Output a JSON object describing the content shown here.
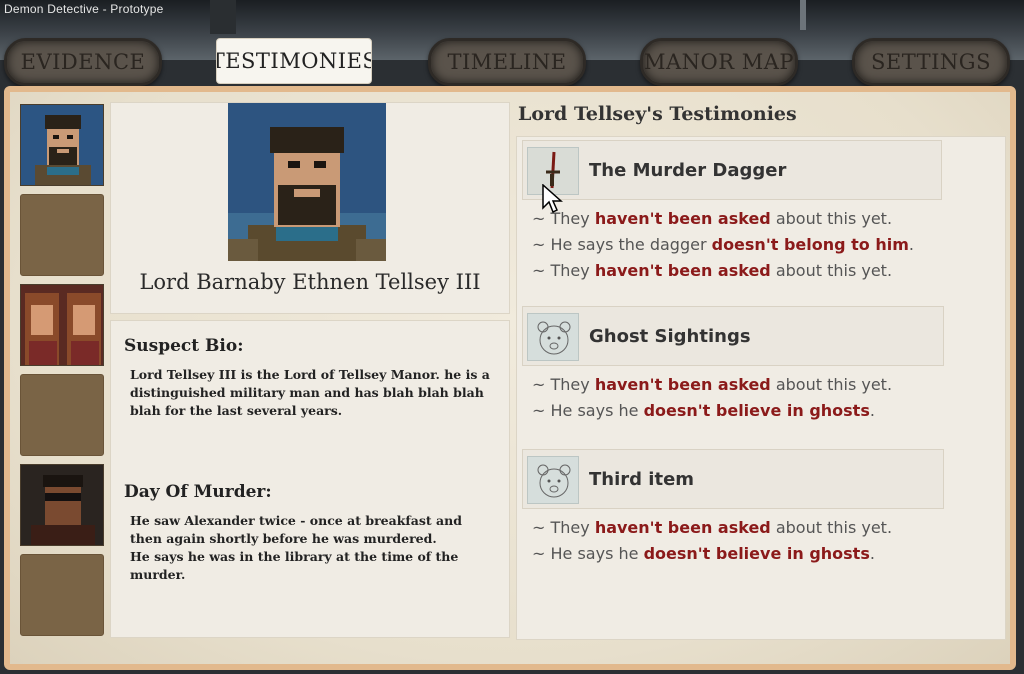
{
  "window": {
    "title": "Demon Detective - Prototype"
  },
  "tabs": [
    {
      "label": "EVIDENCE"
    },
    {
      "label": "TESTIMONIES"
    },
    {
      "label": "TIMELINE"
    },
    {
      "label": "MANOR MAP"
    },
    {
      "label": "SETTINGS"
    }
  ],
  "active_tab": "TESTIMONIES",
  "suspect": {
    "name": "Lord Barnaby Ethnen Tellsey III",
    "bio_heading": "Suspect Bio:",
    "bio_text": "Lord Tellsey III is the Lord of Tellsey Manor. he is a distinguished military man and has blah blah blah blah for the last several years.",
    "day_heading": "Day Of Murder:",
    "day_text_1": "He saw Alexander twice - once at breakfast and then again shortly before he was murdered.",
    "day_text_2": "He says he was in the library at the time of the murder."
  },
  "testimonies": {
    "title": "Lord Tellsey's Testimonies",
    "items": [
      {
        "title": "The Murder Dagger",
        "icon": "dagger-icon",
        "lines": [
          {
            "pre": "~ They ",
            "hl": "haven't been asked",
            "post": " about this yet."
          },
          {
            "pre": "~ He says the dagger ",
            "hl": "doesn't belong to him",
            "post": "."
          },
          {
            "pre": "~ They ",
            "hl": "haven't been asked",
            "post": " about this yet."
          }
        ]
      },
      {
        "title": "Ghost Sightings",
        "icon": "ghost-sketch-icon",
        "lines": [
          {
            "pre": "~ They ",
            "hl": "haven't been asked",
            "post": " about this yet."
          },
          {
            "pre": "~ He says he ",
            "hl": "doesn't believe in ghosts",
            "post": "."
          }
        ]
      },
      {
        "title": "Third item",
        "icon": "ghost-sketch-icon",
        "lines": [
          {
            "pre": "~ They ",
            "hl": "haven't been asked",
            "post": " about this yet."
          },
          {
            "pre": "~ He says he ",
            "hl": "doesn't believe in ghosts",
            "post": "."
          }
        ]
      }
    ]
  },
  "colors": {
    "highlight": "#8b1a1a",
    "panel_border": "#e2b98d",
    "empty_slot": "#7a6446"
  }
}
